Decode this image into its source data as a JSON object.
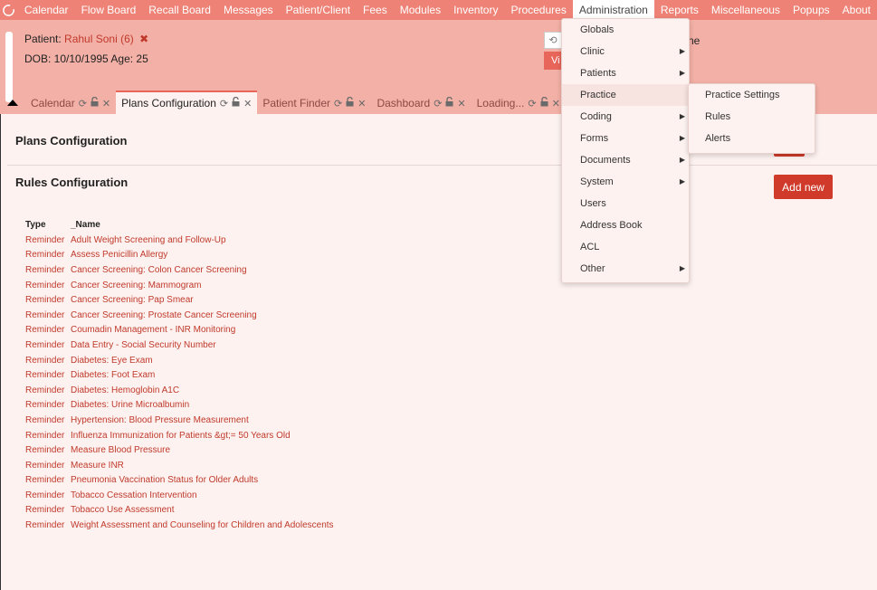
{
  "menubar": {
    "items": [
      "Calendar",
      "Flow Board",
      "Recall Board",
      "Messages",
      "Patient/Client",
      "Fees",
      "Modules",
      "Inventory",
      "Procedures",
      "Administration",
      "Reports",
      "Miscellaneous",
      "Popups",
      "About"
    ],
    "active_index": 9,
    "accent_color": "#ef8276"
  },
  "patient": {
    "label": "Patient:",
    "name": "Rahul Soni (6)",
    "close_glyph": "✖",
    "dob_line": "DOB: 10/10/1995 Age: 25",
    "history_glyph": "⟲",
    "view_text": "Vi",
    "right_text": "ne"
  },
  "tabs": [
    {
      "label": "Calendar",
      "active": false
    },
    {
      "label": "Plans Configuration",
      "active": true
    },
    {
      "label": "Patient Finder",
      "active": false
    },
    {
      "label": "Dashboard",
      "active": false
    },
    {
      "label": "Loading...",
      "active": false
    }
  ],
  "main": {
    "plans_title": "Plans Configuration",
    "rules_title": "Rules Configuration",
    "add_new_label": "Add new",
    "table": {
      "headers": [
        "Type",
        "_Name"
      ],
      "rows": [
        [
          "Reminder",
          "Adult Weight Screening and Follow-Up"
        ],
        [
          "Reminder",
          "Assess Penicillin Allergy"
        ],
        [
          "Reminder",
          "Cancer Screening: Colon Cancer Screening"
        ],
        [
          "Reminder",
          "Cancer Screening: Mammogram"
        ],
        [
          "Reminder",
          "Cancer Screening: Pap Smear"
        ],
        [
          "Reminder",
          "Cancer Screening: Prostate Cancer Screening"
        ],
        [
          "Reminder",
          "Coumadin Management - INR Monitoring"
        ],
        [
          "Reminder",
          "Data Entry - Social Security Number"
        ],
        [
          "Reminder",
          "Diabetes: Eye Exam"
        ],
        [
          "Reminder",
          "Diabetes: Foot Exam"
        ],
        [
          "Reminder",
          "Diabetes: Hemoglobin A1C"
        ],
        [
          "Reminder",
          "Diabetes: Urine Microalbumin"
        ],
        [
          "Reminder",
          "Hypertension: Blood Pressure Measurement"
        ],
        [
          "Reminder",
          "Influenza Immunization for Patients &gt;= 50 Years Old"
        ],
        [
          "Reminder",
          "Measure Blood Pressure"
        ],
        [
          "Reminder",
          "Measure INR"
        ],
        [
          "Reminder",
          "Pneumonia Vaccination Status for Older Adults"
        ],
        [
          "Reminder",
          "Tobacco Cessation Intervention"
        ],
        [
          "Reminder",
          "Tobacco Use Assessment"
        ],
        [
          "Reminder",
          "Weight Assessment and Counseling for Children and Adolescents"
        ]
      ]
    }
  },
  "admin_menu": {
    "items": [
      {
        "label": "Globals",
        "submenu": false
      },
      {
        "label": "Clinic",
        "submenu": true
      },
      {
        "label": "Patients",
        "submenu": true
      },
      {
        "label": "Practice",
        "submenu": false,
        "hover": true
      },
      {
        "label": "Coding",
        "submenu": true
      },
      {
        "label": "Forms",
        "submenu": true
      },
      {
        "label": "Documents",
        "submenu": true
      },
      {
        "label": "System",
        "submenu": true
      },
      {
        "label": "Users",
        "submenu": false
      },
      {
        "label": "Address Book",
        "submenu": false
      },
      {
        "label": "ACL",
        "submenu": false
      },
      {
        "label": "Other",
        "submenu": true
      }
    ]
  },
  "practice_menu": {
    "items": [
      "Practice Settings",
      "Rules",
      "Alerts"
    ]
  }
}
